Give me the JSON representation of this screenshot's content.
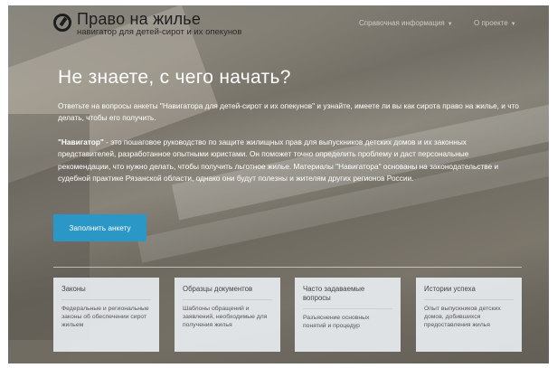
{
  "header": {
    "logo_title": "Право на жилье",
    "logo_subtitle": "навигатор для детей-сирот и их опекунов",
    "nav": [
      {
        "label": "Справочная информация",
        "icon": "caret-down-icon"
      },
      {
        "label": "О проекте",
        "icon": "caret-down-icon"
      }
    ]
  },
  "hero": {
    "title": "Не знаете, с чего начать?",
    "paragraph1": "Ответьте на вопросы анкеты \"Навигатора для детей-сирот и их опекунов\" и узнайте, имеете ли вы как сирота право на жилье, и что делать, чтобы его получить.",
    "paragraph2_bold": "\"Навигатор\"",
    "paragraph2_rest": " - это пошаговое руководство по защите жилищных прав для выпускников детских домов и их законных представителей, разработанное опытными юристами. Он поможет точно определить проблему и даст персональные рекомендации, что нужно делать, чтобы получить льготное жилье. Материалы \"Навигатора\" основаны на законодательстве и судебной практике Рязанской области, однако они будут полезны и жителям других регионов России.",
    "cta_label": "Заполнить анкету"
  },
  "cards": [
    {
      "title": "Законы",
      "desc": "Федеральные и региональные законы об обеспечении сирот жильем"
    },
    {
      "title": "Образцы документов",
      "desc": "Шаблоны обращений и заявлений, необходимые для получения жилья"
    },
    {
      "title": "Часто задаваемые вопросы",
      "desc": "Разъяснение основных понятий и процедур"
    },
    {
      "title": "Истории успеха",
      "desc": "Опыт выпускников детских домов, добившихся предоставления жилья"
    }
  ],
  "colors": {
    "accent": "#2a97c6",
    "card_bg": "#ebf0f3",
    "hero_text": "#ffffff"
  }
}
